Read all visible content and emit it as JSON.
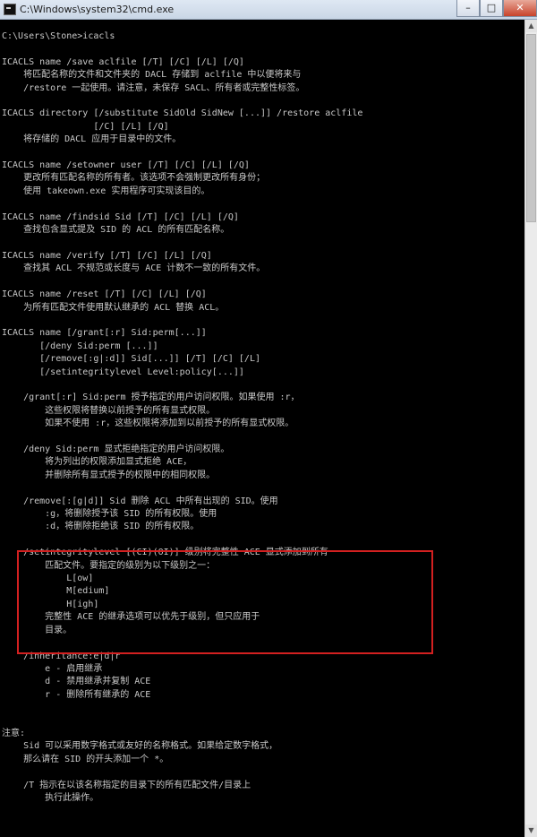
{
  "window": {
    "title": "C:\\Windows\\system32\\cmd.exe",
    "minimize_symbol": "–",
    "maximize_symbol": "□",
    "close_symbol": "✕"
  },
  "scrollbar": {
    "up_arrow": "▲",
    "down_arrow": "▼"
  },
  "console": {
    "text": "C:\\Users\\Stone>icacls\n\nICACLS name /save aclfile [/T] [/C] [/L] [/Q]\n    将匹配名称的文件和文件夹的 DACL 存储到 aclfile 中以便将来与\n    /restore 一起使用。请注意，未保存 SACL、所有者或完整性标签。\n\nICACLS directory [/substitute SidOld SidNew [...]] /restore aclfile\n                 [/C] [/L] [/Q]\n    将存储的 DACL 应用于目录中的文件。\n\nICACLS name /setowner user [/T] [/C] [/L] [/Q]\n    更改所有匹配名称的所有者。该选项不会强制更改所有身份；\n    使用 takeown.exe 实用程序可实现该目的。\n\nICACLS name /findsid Sid [/T] [/C] [/L] [/Q]\n    查找包含显式提及 SID 的 ACL 的所有匹配名称。\n\nICACLS name /verify [/T] [/C] [/L] [/Q]\n    查找其 ACL 不规范或长度与 ACE 计数不一致的所有文件。\n\nICACLS name /reset [/T] [/C] [/L] [/Q]\n    为所有匹配文件使用默认继承的 ACL 替换 ACL。\n\nICACLS name [/grant[:r] Sid:perm[...]]\n       [/deny Sid:perm [...]]\n       [/remove[:g|:d]] Sid[...]] [/T] [/C] [/L]\n       [/setintegritylevel Level:policy[...]]\n\n    /grant[:r] Sid:perm 授予指定的用户访问权限。如果使用 :r，\n        这些权限将替换以前授予的所有显式权限。\n        如果不使用 :r，这些权限将添加到以前授予的所有显式权限。\n\n    /deny Sid:perm 显式拒绝指定的用户访问权限。\n        将为列出的权限添加显式拒绝 ACE，\n        并删除所有显式授予的权限中的相同权限。\n\n    /remove[:[g|d]] Sid 删除 ACL 中所有出现的 SID。使用\n        :g，将删除授予该 SID 的所有权限。使用\n        :d，将删除拒绝该 SID 的所有权限。\n\n    /setintegritylevel [(CI)(OI)] 级别将完整性 ACE 显式添加到所有\n        匹配文件。要指定的级别为以下级别之一：\n            L[ow]\n            M[edium]\n            H[igh]\n        完整性 ACE 的继承选项可以优先于级别，但只应用于\n        目录。\n\n    /inheritance:e|d|r\n        e - 启用继承\n        d - 禁用继承并复制 ACE\n        r - 删除所有继承的 ACE\n\n\n注意:\n    Sid 可以采用数字格式或友好的名称格式。如果给定数字格式，\n    那么请在 SID 的开头添加一个 *。\n\n    /T 指示在以该名称指定的目录下的所有匹配文件/目录上\n        执行此操作。"
  }
}
